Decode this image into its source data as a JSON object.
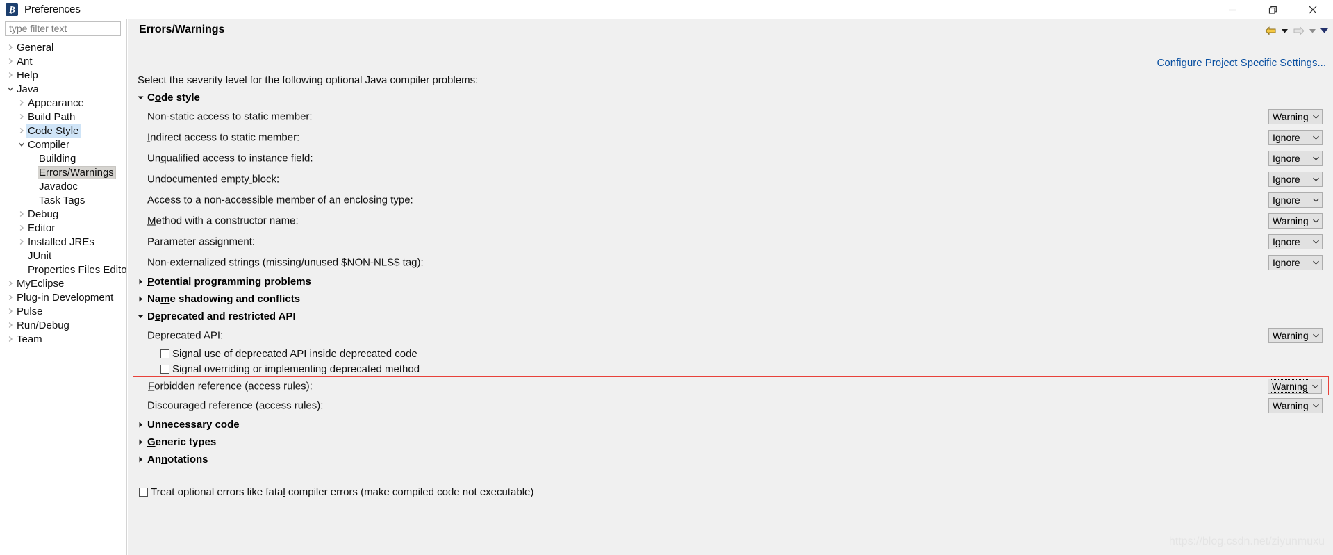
{
  "window": {
    "title": "Preferences",
    "icon": "eclipse-preferences-icon",
    "minimize_label": "minimize-icon",
    "maximize_label": "restore-icon",
    "close_label": "close-icon"
  },
  "filter": {
    "placeholder": "type filter text",
    "value": ""
  },
  "tree": {
    "items": [
      {
        "label": "General",
        "indent": 0,
        "twisty": "collapsed",
        "state": "normal"
      },
      {
        "label": "Ant",
        "indent": 0,
        "twisty": "collapsed",
        "state": "normal"
      },
      {
        "label": "Help",
        "indent": 0,
        "twisty": "collapsed",
        "state": "normal"
      },
      {
        "label": "Java",
        "indent": 0,
        "twisty": "expanded",
        "state": "normal"
      },
      {
        "label": "Appearance",
        "indent": 1,
        "twisty": "collapsed",
        "state": "normal"
      },
      {
        "label": "Build Path",
        "indent": 1,
        "twisty": "collapsed",
        "state": "normal"
      },
      {
        "label": "Code Style",
        "indent": 1,
        "twisty": "collapsed",
        "state": "highlighted"
      },
      {
        "label": "Compiler",
        "indent": 1,
        "twisty": "expanded",
        "state": "normal"
      },
      {
        "label": "Building",
        "indent": 2,
        "twisty": "none",
        "state": "normal"
      },
      {
        "label": "Errors/Warnings",
        "indent": 2,
        "twisty": "none",
        "state": "selected"
      },
      {
        "label": "Javadoc",
        "indent": 2,
        "twisty": "none",
        "state": "normal"
      },
      {
        "label": "Task Tags",
        "indent": 2,
        "twisty": "none",
        "state": "normal"
      },
      {
        "label": "Debug",
        "indent": 1,
        "twisty": "collapsed",
        "state": "normal"
      },
      {
        "label": "Editor",
        "indent": 1,
        "twisty": "collapsed",
        "state": "normal"
      },
      {
        "label": "Installed JREs",
        "indent": 1,
        "twisty": "collapsed",
        "state": "normal"
      },
      {
        "label": "JUnit",
        "indent": 1,
        "twisty": "none",
        "state": "normal"
      },
      {
        "label": "Properties Files Edito",
        "indent": 1,
        "twisty": "none",
        "state": "normal"
      },
      {
        "label": "MyEclipse",
        "indent": 0,
        "twisty": "collapsed",
        "state": "normal"
      },
      {
        "label": "Plug-in Development",
        "indent": 0,
        "twisty": "collapsed",
        "state": "normal"
      },
      {
        "label": "Pulse",
        "indent": 0,
        "twisty": "collapsed",
        "state": "normal"
      },
      {
        "label": "Run/Debug",
        "indent": 0,
        "twisty": "collapsed",
        "state": "normal"
      },
      {
        "label": "Team",
        "indent": 0,
        "twisty": "collapsed",
        "state": "normal"
      }
    ]
  },
  "page": {
    "title": "Errors/Warnings",
    "configure_link": "Configure Project Specific Settings...",
    "intro": "Select the severity level for the following optional Java compiler problems:",
    "nav": {
      "back": "back-arrow-icon",
      "back_menu": "back-dropdown-icon",
      "forward": "forward-arrow-icon",
      "forward_menu": "forward-dropdown-icon",
      "view_menu": "view-menu-icon"
    }
  },
  "sections": [
    {
      "id": "code-style",
      "label": "Code style",
      "mnemonic_index": 1,
      "expanded": true,
      "rows": [
        {
          "type": "option",
          "label": "Non-static access to static member:",
          "mnemonic_index": -1,
          "value": "Warning"
        },
        {
          "type": "option",
          "label": "Indirect access to static member:",
          "mnemonic_index": 0,
          "value": "Ignore"
        },
        {
          "type": "option",
          "label": "Unqualified access to instance field:",
          "mnemonic_index": 2,
          "value": "Ignore"
        },
        {
          "type": "option",
          "label": "Undocumented empty block:",
          "mnemonic_index": 18,
          "value": "Ignore"
        },
        {
          "type": "option",
          "label": "Access to a non-accessible member of an enclosing type:",
          "mnemonic_index": -1,
          "value": "Ignore"
        },
        {
          "type": "option",
          "label": "Method with a constructor name:",
          "mnemonic_index": 0,
          "value": "Warning"
        },
        {
          "type": "option",
          "label": "Parameter assignment:",
          "mnemonic_index": -1,
          "value": "Ignore"
        },
        {
          "type": "option",
          "label": "Non-externalized strings (missing/unused $NON-NLS$ tag):",
          "mnemonic_index": -1,
          "value": "Ignore"
        }
      ]
    },
    {
      "id": "potential-programming-problems",
      "label": "Potential programming problems",
      "mnemonic_index": 0,
      "expanded": false,
      "rows": []
    },
    {
      "id": "name-shadowing-and-conflicts",
      "label": "Name shadowing and conflicts",
      "mnemonic_index": 2,
      "expanded": false,
      "rows": []
    },
    {
      "id": "deprecated-and-restricted-api",
      "label": "Deprecated and restricted API",
      "mnemonic_index": 1,
      "expanded": true,
      "rows": [
        {
          "type": "option",
          "label": "Deprecated API:",
          "mnemonic_index": -1,
          "value": "Warning"
        },
        {
          "type": "checkbox",
          "label": "Signal use of deprecated API inside deprecated code",
          "checked": false
        },
        {
          "type": "checkbox",
          "label": "Signal overriding or implementing deprecated method",
          "checked": false
        },
        {
          "type": "option",
          "label": "Forbidden reference (access rules):",
          "mnemonic_index": 0,
          "value": "Warning",
          "highlighted": true,
          "focused": true
        },
        {
          "type": "option",
          "label": "Discouraged reference (access rules):",
          "mnemonic_index": -1,
          "value": "Warning"
        }
      ]
    },
    {
      "id": "unnecessary-code",
      "label": "Unnecessary code",
      "mnemonic_index": 0,
      "expanded": false,
      "rows": []
    },
    {
      "id": "generic-types",
      "label": "Generic types",
      "mnemonic_index": 0,
      "expanded": false,
      "rows": []
    },
    {
      "id": "annotations",
      "label": "Annotations",
      "mnemonic_index": 2,
      "expanded": false,
      "rows": []
    }
  ],
  "footer": {
    "treat_optional_errors": {
      "label": "Treat optional errors like fatal compiler errors (make compiled code not executable)",
      "mnemonic_index": 31,
      "checked": false
    }
  },
  "watermark": "https://blog.csdn.net/ziyunmuxu",
  "colors": {
    "panel_bg": "#f0f0f0",
    "link": "#0a50a1",
    "highlight_border": "#e8413a",
    "tree_selection": "#d6d4d0",
    "tree_highlight": "#cfe4f7",
    "combo_bg": "#e1e1e1"
  }
}
